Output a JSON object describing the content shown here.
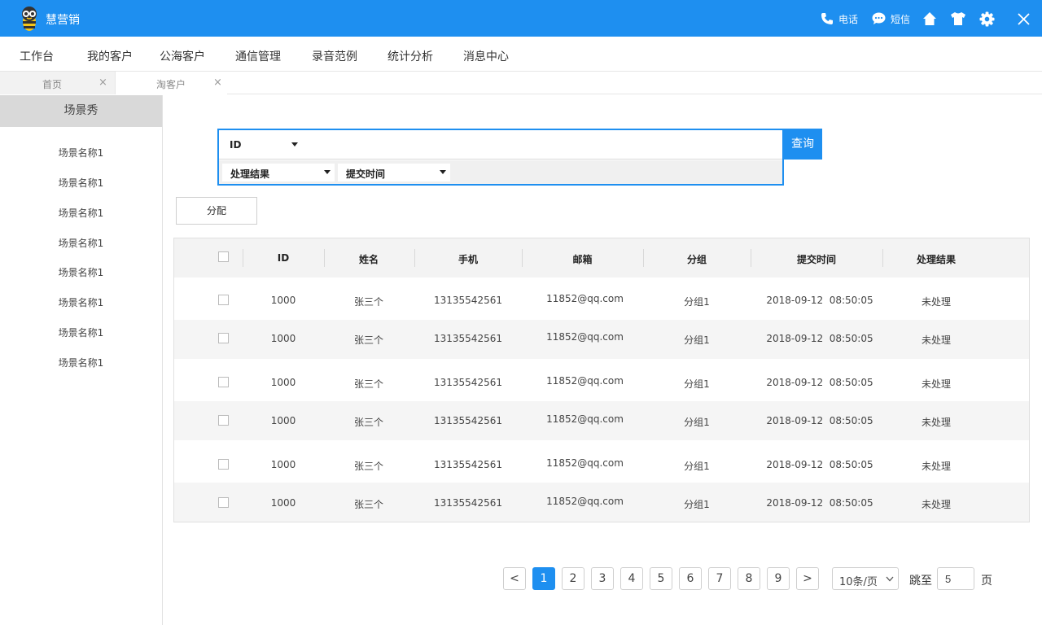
{
  "app": {
    "title": "慧营销",
    "brand_color": "#1e8ff0"
  },
  "top_actions": {
    "phone_label": "电话",
    "sms_label": "短信"
  },
  "main_nav": [
    "工作台",
    "我的客户",
    "公海客户",
    "通信管理",
    "录音范例",
    "统计分析",
    "消息中心"
  ],
  "tabs": [
    {
      "label": "首页",
      "close": "×"
    },
    {
      "label": "淘客户",
      "close": "×"
    }
  ],
  "sidebar": {
    "title": "场景秀",
    "items": [
      "场景名称1",
      "场景名称1",
      "场景名称1",
      "场景名称1",
      "场景名称1",
      "场景名称1",
      "场景名称1",
      "场景名称1"
    ]
  },
  "search": {
    "field_select": "ID",
    "value": "",
    "filters": [
      "处理结果",
      "提交时间"
    ],
    "button": "查询"
  },
  "assign_button": "分配",
  "table": {
    "columns": [
      "ID",
      "姓名",
      "手机",
      "邮箱",
      "分组",
      "提交时间",
      "处理结果"
    ],
    "rows": [
      {
        "id": "1000",
        "name": "张三个",
        "phone": "13135542561",
        "email": "11852@qq.com",
        "group": "分组1",
        "time": "2018-09-12  08:50:05",
        "status": "未处理"
      },
      {
        "id": "1000",
        "name": "张三个",
        "phone": "13135542561",
        "email": "11852@qq.com",
        "group": "分组1",
        "time": "2018-09-12  08:50:05",
        "status": "未处理"
      },
      {
        "id": "1000",
        "name": "张三个",
        "phone": "13135542561",
        "email": "11852@qq.com",
        "group": "分组1",
        "time": "2018-09-12  08:50:05",
        "status": "未处理"
      },
      {
        "id": "1000",
        "name": "张三个",
        "phone": "13135542561",
        "email": "11852@qq.com",
        "group": "分组1",
        "time": "2018-09-12  08:50:05",
        "status": "未处理"
      },
      {
        "id": "1000",
        "name": "张三个",
        "phone": "13135542561",
        "email": "11852@qq.com",
        "group": "分组1",
        "time": "2018-09-12  08:50:05",
        "status": "未处理"
      },
      {
        "id": "1000",
        "name": "张三个",
        "phone": "13135542561",
        "email": "11852@qq.com",
        "group": "分组1",
        "time": "2018-09-12  08:50:05",
        "status": "未处理"
      }
    ]
  },
  "pagination": {
    "prev": "<",
    "next": ">",
    "pages": [
      "1",
      "2",
      "3",
      "4",
      "5",
      "6",
      "7",
      "8",
      "9"
    ],
    "current": "1",
    "page_size": "10条/页",
    "jump_label": "跳至",
    "jump_value": "5",
    "page_suffix": "页"
  }
}
